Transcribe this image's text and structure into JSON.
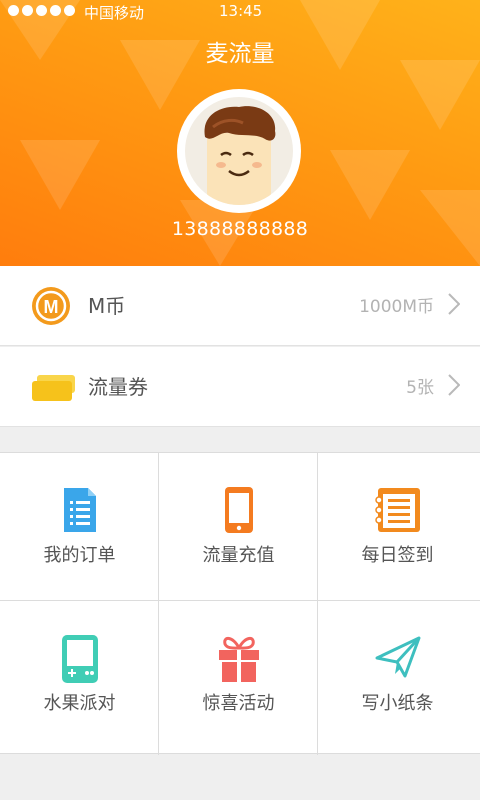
{
  "status_bar": {
    "carrier": "中国移动",
    "time": "13:45"
  },
  "header": {
    "title": "麦流量",
    "phone": "13888888888"
  },
  "account": {
    "coins": {
      "label": "M币",
      "value": "1000M币",
      "icon": "m-coin-icon",
      "icon_letter": "M"
    },
    "coupons": {
      "label": "流量券",
      "value": "5张",
      "icon": "ticket-icon"
    }
  },
  "menu": [
    {
      "label": "我的订单",
      "icon": "document-icon",
      "color": "#3aa6ea"
    },
    {
      "label": "流量充值",
      "icon": "phone-icon",
      "color": "#f47b20"
    },
    {
      "label": "每日签到",
      "icon": "notebook-icon",
      "color": "#f28a1e"
    },
    {
      "label": "水果派对",
      "icon": "handheld-game-icon",
      "color": "#40cdb5"
    },
    {
      "label": "惊喜活动",
      "icon": "gift-icon",
      "color": "#f2645e"
    },
    {
      "label": "写小纸条",
      "icon": "paper-plane-icon",
      "color": "#3ebfbf"
    }
  ],
  "colors": {
    "header_top": "#ffb21a",
    "header_bottom": "#ff7d0d",
    "coin": "#f39a1c",
    "coupon": "#f6c21b"
  }
}
